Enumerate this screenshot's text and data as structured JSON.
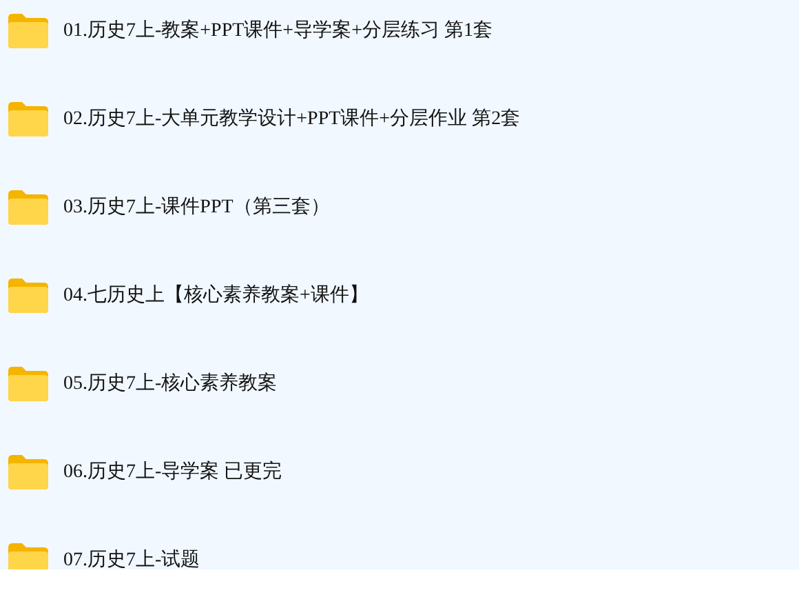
{
  "folders": [
    {
      "name": "01.历史7上-教案+PPT课件+导学案+分层练习 第1套"
    },
    {
      "name": "02.历史7上-大单元教学设计+PPT课件+分层作业 第2套"
    },
    {
      "name": "03.历史7上-课件PPT（第三套）"
    },
    {
      "name": "04.七历史上【核心素养教案+课件】"
    },
    {
      "name": "05.历史7上-核心素养教案"
    },
    {
      "name": "06.历史7上-导学案 已更完"
    },
    {
      "name": "07.历史7上-试题"
    }
  ]
}
